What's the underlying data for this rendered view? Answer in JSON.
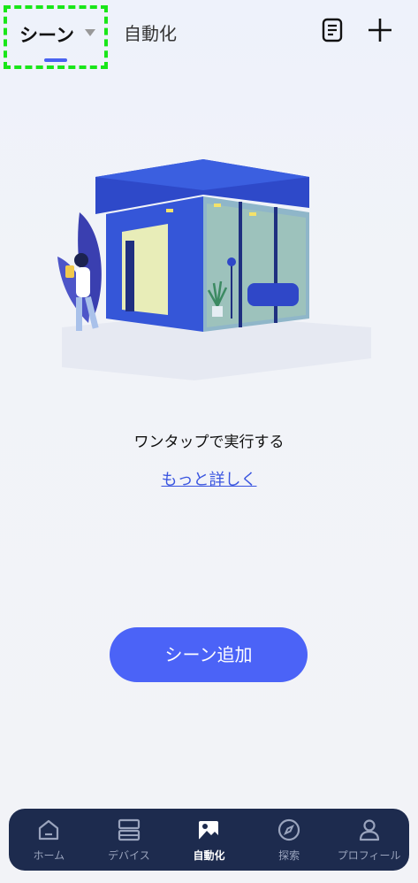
{
  "header": {
    "tab_scenes": "シーン",
    "tab_automation": "自動化",
    "log_icon": "document-list-icon",
    "add_icon": "plus-icon"
  },
  "empty_state": {
    "message": "ワンタップで実行する",
    "learn_more": "もっと詳しく"
  },
  "add_button": {
    "label": "シーン追加"
  },
  "bottom_nav": {
    "items": [
      {
        "label": "ホーム",
        "icon": "home-icon"
      },
      {
        "label": "デバイス",
        "icon": "devices-icon"
      },
      {
        "label": "自動化",
        "icon": "automation-icon",
        "active": true
      },
      {
        "label": "探索",
        "icon": "compass-icon"
      },
      {
        "label": "プロフィール",
        "icon": "profile-icon"
      }
    ]
  },
  "colors": {
    "accent": "#4b63f7",
    "link": "#3a55e0",
    "nav_bg": "#1d2b4e",
    "highlight_border": "#19e619"
  }
}
